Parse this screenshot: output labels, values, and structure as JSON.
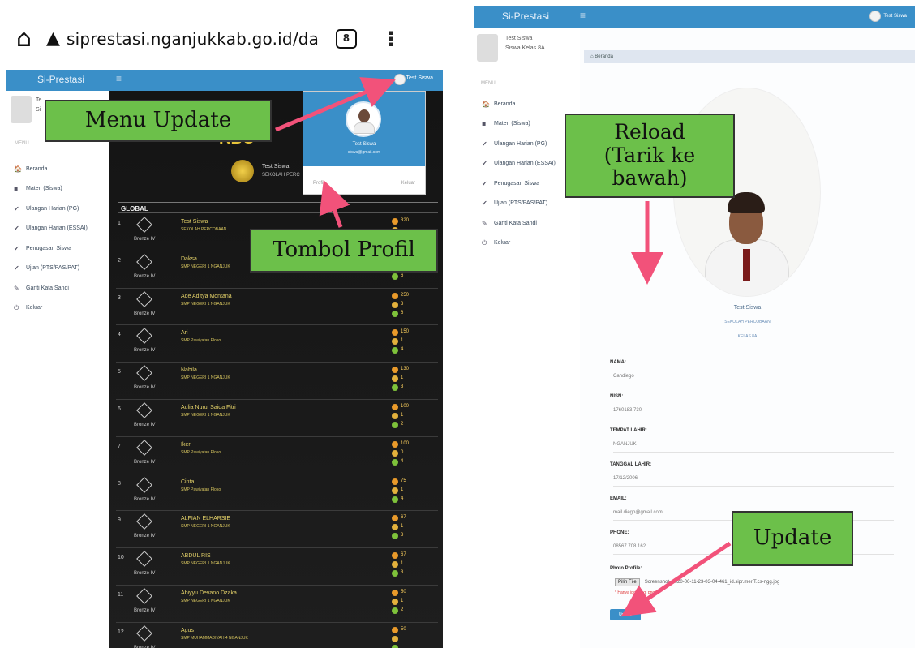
{
  "browser": {
    "url": "siprestasi.nganjukkab.go.id/dashbo",
    "tab_count": "8",
    "icons": [
      "home-icon",
      "warning-icon",
      "tabs-icon",
      "more-icon"
    ]
  },
  "colors": {
    "navbar": "#3a8fc8",
    "annotation": "#6cc04a",
    "arrow": "#f2527a",
    "leaderboard_bg": "#1c1c1c"
  },
  "left": {
    "navbar": {
      "brand": "Si-Prestasi",
      "menu_icon": "≡",
      "user": "Test Siswa"
    },
    "sidebar": {
      "profile_name": "Te",
      "profile_sub": "Si",
      "section": "MENU",
      "items": [
        {
          "icon": "home-icon",
          "glyph": "🏠",
          "label": "Beranda"
        },
        {
          "icon": "folder-icon",
          "glyph": "▪",
          "label": "Materi (Siswa)"
        },
        {
          "icon": "check-icon",
          "glyph": "✔",
          "label": "Ulangan Harian (PG)"
        },
        {
          "icon": "check-icon",
          "glyph": "✔",
          "label": "Ulangan Harian (ESSAI)"
        },
        {
          "icon": "check-icon",
          "glyph": "✔",
          "label": "Penugasan Siswa"
        },
        {
          "icon": "check-icon",
          "glyph": "✔",
          "label": "Ujian (PTS/PAS/PAT)"
        },
        {
          "icon": "key-icon",
          "glyph": "✎",
          "label": "Ganti Kata Sandi"
        },
        {
          "icon": "logout-icon",
          "glyph": "⏻",
          "label": "Keluar"
        }
      ]
    },
    "leaderboard": {
      "title_fragment": "RBO",
      "top_name": "Test Siswa",
      "top_school": "SEKOLAH PERC",
      "section": "GLOBAL",
      "rows": [
        {
          "rank": "1",
          "tier": "Bronze IV",
          "name": "Test Siswa",
          "school": "SEKOLAH PERCOBAAN",
          "points": "320",
          "b": "",
          "c": ""
        },
        {
          "rank": "2",
          "tier": "Bronze IV",
          "name": "Daksa",
          "school": "SMP NEGERI 1 NGANJUK",
          "points": "",
          "b": "",
          "c": "6"
        },
        {
          "rank": "3",
          "tier": "Bronze IV",
          "name": "Ade Aditya Montana",
          "school": "SMP NEGERI 1 NGANJUK",
          "points": "250",
          "b": "3",
          "c": "6"
        },
        {
          "rank": "4",
          "tier": "Bronze IV",
          "name": "Ari",
          "school": "SMP Pawiyatan Ploso",
          "points": "150",
          "b": "1",
          "c": "4"
        },
        {
          "rank": "5",
          "tier": "Bronze IV",
          "name": "Nabila",
          "school": "SMP NEGERI 1 NGANJUK",
          "points": "130",
          "b": "1",
          "c": "3"
        },
        {
          "rank": "6",
          "tier": "Bronze IV",
          "name": "Aulia Nurul Saida Fitri",
          "school": "SMP NEGERI 1 NGANJUK",
          "points": "100",
          "b": "1",
          "c": "2"
        },
        {
          "rank": "7",
          "tier": "Bronze IV",
          "name": "Iker",
          "school": "SMP Pawiyatan Ploso",
          "points": "100",
          "b": "0",
          "c": "4"
        },
        {
          "rank": "8",
          "tier": "Bronze IV",
          "name": "Cinta",
          "school": "SMP Pawiyatan Ploso",
          "points": "75",
          "b": "1",
          "c": "4"
        },
        {
          "rank": "9",
          "tier": "Bronze IV",
          "name": "ALFIAN ELHARSIE",
          "school": "SMP NEGERI 1 NGANJUK",
          "points": "67",
          "b": "1",
          "c": "3"
        },
        {
          "rank": "10",
          "tier": "Bronze IV",
          "name": "ABDUL RIS",
          "school": "SMP NEGERI 1 NGANJUK",
          "points": "67",
          "b": "1",
          "c": "3"
        },
        {
          "rank": "11",
          "tier": "Bronze IV",
          "name": "Abiyyu Devano Dzaka",
          "school": "SMP NEGERI 1 NGANJUK",
          "points": "50",
          "b": "1",
          "c": "2"
        },
        {
          "rank": "12",
          "tier": "Bronze IV",
          "name": "Agus",
          "school": "SMP MUHAMMADIYAH 4 NGANJUK",
          "points": "50",
          "b": "",
          "c": ""
        }
      ]
    },
    "popup": {
      "name": "Test Siswa",
      "email": "siswa@gmail.com",
      "profile_btn": "Profil",
      "logout_btn": "Keluar"
    }
  },
  "right": {
    "navbar": {
      "brand": "Si-Prestasi",
      "menu_icon": "≡",
      "user": "Test Siswa"
    },
    "sidebar": {
      "profile_name": "Test Siswa",
      "profile_sub": "Siswa Kelas 8A",
      "section": "MENU",
      "items": [
        {
          "icon": "home-icon",
          "glyph": "🏠",
          "label": "Beranda"
        },
        {
          "icon": "folder-icon",
          "glyph": "▪",
          "label": "Materi (Siswa)"
        },
        {
          "icon": "check-icon",
          "glyph": "✔",
          "label": "Ulangan Harian (PG)"
        },
        {
          "icon": "check-icon",
          "glyph": "✔",
          "label": "Ulangan Harian (ESSAI)"
        },
        {
          "icon": "check-icon",
          "glyph": "✔",
          "label": "Penugasan Siswa"
        },
        {
          "icon": "check-icon",
          "glyph": "✔",
          "label": "Ujian (PTS/PAS/PAT)"
        },
        {
          "icon": "key-icon",
          "glyph": "✎",
          "label": "Ganti Kata Sandi"
        },
        {
          "icon": "logout-icon",
          "glyph": "⏻",
          "label": "Keluar"
        }
      ]
    },
    "breadcrumb": "Beranda",
    "profile": {
      "name": "Test Siswa",
      "school": "SEKOLAH PERCOBAAN",
      "class": "KELAS 8A"
    },
    "form": {
      "fields": [
        {
          "label": "NAMA:",
          "value": "Cahdiego"
        },
        {
          "label": "NISN:",
          "value": "1760183,730"
        },
        {
          "label": "TEMPAT LAHIR:",
          "value": "NGANJUK"
        },
        {
          "label": "TANGGAL LAHIR:",
          "value": "17/12/2006"
        },
        {
          "label": "EMAIL:",
          "value": "mail.diego@gmail.com"
        },
        {
          "label": "PHONE:",
          "value": "08567.708.162"
        }
      ],
      "photo_label": "Photo Profile:",
      "file_button": "Pilih File",
      "file_name": "Screenshot_2020-06-11-23-03-04-461_id.sipr.meriT.cs-ngg.jpg",
      "hint": "* Hanya jpg, jpeg, png",
      "update_btn": "Update"
    }
  },
  "annotations": {
    "menu_update": "Menu Update",
    "tombol_profil": "Tombol Profil",
    "reload": "Reload\n(Tarik ke bawah)",
    "update": "Update"
  }
}
